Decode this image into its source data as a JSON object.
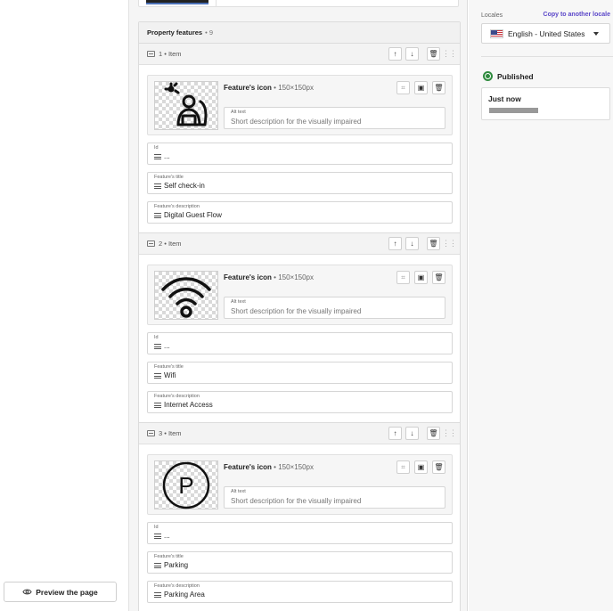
{
  "preview": {
    "label": "Preview the page",
    "icon": "eye-icon"
  },
  "features": {
    "title": "Property features",
    "count": "9",
    "items": [
      {
        "header": "1 • Item",
        "icon_label": "Feature's icon",
        "icon_dims": "150×150px",
        "icon_image": "self-check-in-icon",
        "alt_label": "Alt text",
        "alt_placeholder": "Short description for the visually impaired",
        "id_label": "Id",
        "id_value": "...",
        "title_label": "Feature's title",
        "title_value": "Self check-in",
        "desc_label": "Feature's description",
        "desc_value": "Digital Guest Flow"
      },
      {
        "header": "2 • Item",
        "icon_label": "Feature's icon",
        "icon_dims": "150×150px",
        "icon_image": "wifi-icon",
        "alt_label": "Alt text",
        "alt_placeholder": "Short description for the visually impaired",
        "id_label": "Id",
        "id_value": "...",
        "title_label": "Feature's title",
        "title_value": "Wifi",
        "desc_label": "Feature's description",
        "desc_value": "Internet Access"
      },
      {
        "header": "3 • Item",
        "icon_label": "Feature's icon",
        "icon_dims": "150×150px",
        "icon_image": "parking-icon",
        "alt_label": "Alt text",
        "alt_placeholder": "Short description for the visually impaired",
        "id_label": "Id",
        "id_value": "...",
        "title_label": "Feature's title",
        "title_value": "Parking",
        "desc_label": "Feature's description",
        "desc_value": "Parking Area"
      }
    ]
  },
  "sidebar": {
    "locales_label": "Locales",
    "copy_link": "Copy to another locale",
    "locale_value": "English - United States",
    "status": "Published",
    "status_color": "#2f8a3e",
    "last_saved": "Just now"
  },
  "colors": {
    "accent": "#5b47c9"
  }
}
